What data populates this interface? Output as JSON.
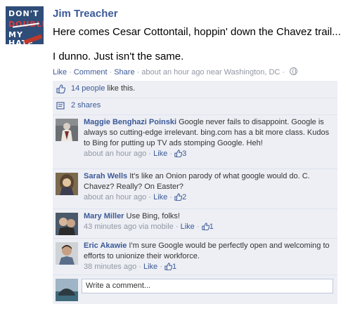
{
  "post": {
    "author_logo": {
      "line1": "DON'T",
      "line2": "DOUBLE",
      "line3": "MY HATE"
    },
    "author": "Jim Treacher",
    "message_line1": "Here comes Cesar Cottontail, hoppin' down the Chavez trail...",
    "message_line2": "I dunno. Just isn't the same.",
    "actions": {
      "like": "Like",
      "comment": "Comment",
      "share": "Share",
      "timestamp": "about an hour ago near Washington, DC"
    },
    "likes": {
      "count_text": "14 people",
      "suffix": " like this."
    },
    "shares": {
      "text": "2 shares"
    },
    "comments": [
      {
        "name": "Maggie Benghazi Poinski",
        "text": "Google never fails to disappoint. Google is always so cutting-edge irrelevant. bing.com has a bit more class. Kudos to Bing for putting up TV ads stomping Google. Heh!",
        "time": "about an hour ago",
        "via": "",
        "like_label": "Like",
        "like_count": "3"
      },
      {
        "name": "Sarah Wells",
        "text": "It's like an Onion parody of what google would do. C. Chavez? Really? On Easter?",
        "time": "about an hour ago",
        "via": "",
        "like_label": "Like",
        "like_count": "2"
      },
      {
        "name": "Mary Miller",
        "text": "Use Bing, folks!",
        "time": "43 minutes ago",
        "via": "via mobile",
        "like_label": "Like",
        "like_count": "1"
      },
      {
        "name": "Eric Akawie",
        "text": "I'm sure Google would be perfectly open and welcoming to efforts to unionize their workforce.",
        "time": "38 minutes ago",
        "via": "",
        "like_label": "Like",
        "like_count": "1"
      }
    ],
    "write_comment": {
      "placeholder": "Write a comment..."
    }
  },
  "colors": {
    "link": "#3b5998",
    "meta": "#9197a3",
    "ufi_bg": "#edeff4",
    "divider": "#dfe3ee"
  }
}
